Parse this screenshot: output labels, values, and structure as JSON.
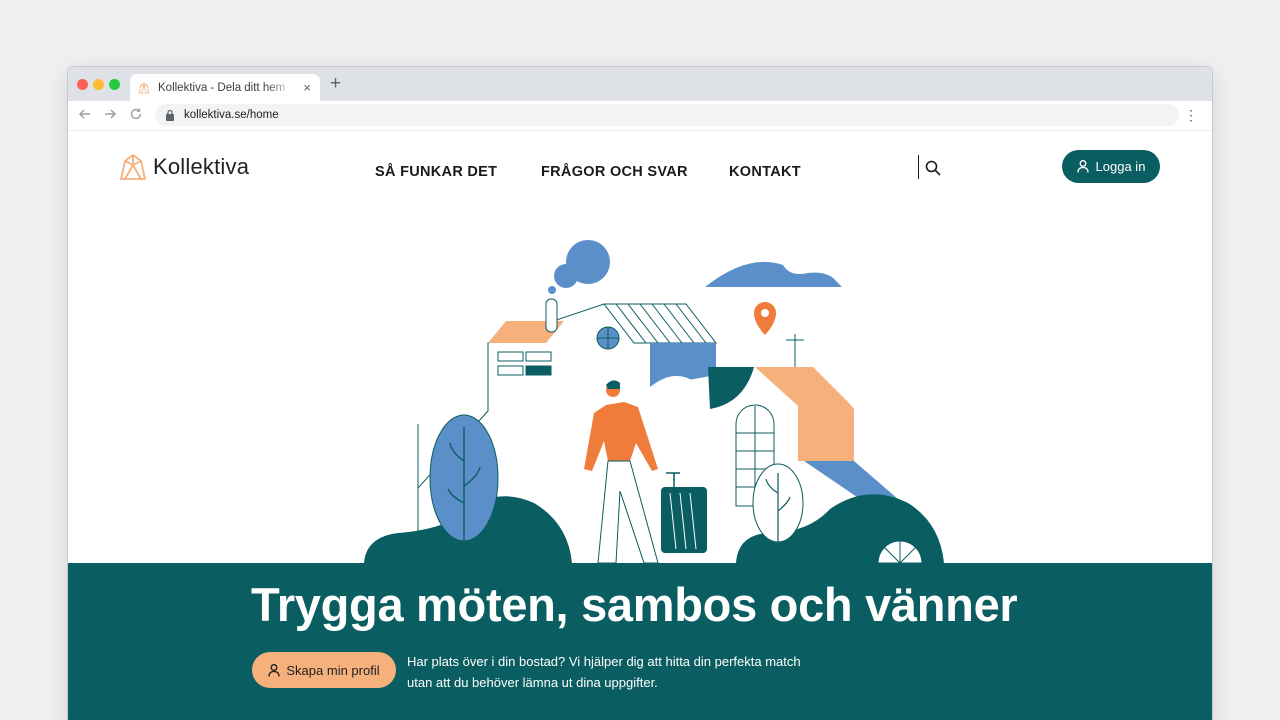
{
  "browser": {
    "tab_title": "Kollektiva - Dela ditt hem",
    "new_tab": "+",
    "tab_close": "×",
    "url": "kollektiva.se/home",
    "menu": "⋮"
  },
  "header": {
    "logo_text": "Kollektiva",
    "nav": [
      "SÅ FUNKAR DET",
      "FRÅGOR OCH SVAR",
      "KONTAKT"
    ],
    "login_label": "Logga in"
  },
  "hero": {
    "title": "Trygga möten, sambos och vänner",
    "cta_label": "Skapa min profil",
    "description": "Har plats över i din bostad? Vi hjälper dig att hitta din perfekta match utan att du behöver lämna ut dina uppgifter."
  },
  "colors": {
    "brand_teal": "#0a5d60",
    "accent_orange": "#f5b07c",
    "orange": "#ef7c3a",
    "blue": "#5b8fc9"
  }
}
